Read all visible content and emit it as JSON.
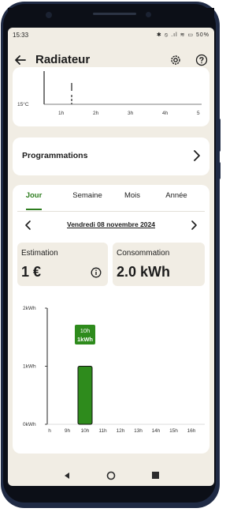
{
  "status": {
    "time": "15:33",
    "icons_text": "✱ ⦸ .ıl ≋ ▭ 50%"
  },
  "appbar": {
    "title": "Radiateur",
    "back_icon": "arrow-left-icon",
    "settings_icon": "gear-icon",
    "help_icon": "question-circle-icon"
  },
  "mini_chart": {
    "y_label": "15°C",
    "x_labels": [
      "1h",
      "2h",
      "3h",
      "4h",
      "5"
    ]
  },
  "programmations": {
    "label": "Programmations"
  },
  "tabs": [
    {
      "label": "Jour",
      "active": true
    },
    {
      "label": "Semaine",
      "active": false
    },
    {
      "label": "Mois",
      "active": false
    },
    {
      "label": "Année",
      "active": false
    }
  ],
  "date": {
    "label": "Vendredi 08 novembre 2024"
  },
  "estimation": {
    "label": "Estimation",
    "value": "1 €"
  },
  "consommation": {
    "label": "Consommation",
    "value": "2.0 kWh"
  },
  "chart_data": {
    "type": "bar",
    "categories": [
      "h",
      "9h",
      "10h",
      "11h",
      "12h",
      "13h",
      "14h",
      "15h",
      "16h"
    ],
    "values": [
      0,
      0,
      1,
      0,
      0,
      0,
      0,
      0,
      0
    ],
    "y_ticks": [
      "0kWh",
      "1kWh",
      "2kWh"
    ],
    "ylim": [
      0,
      2
    ],
    "tooltip": {
      "hour": "10h",
      "value": "1kWh"
    },
    "bar_color": "#2e8b1c"
  },
  "colors": {
    "accent": "#2e7d1f",
    "background": "#f1ede4",
    "card": "#ffffff"
  }
}
